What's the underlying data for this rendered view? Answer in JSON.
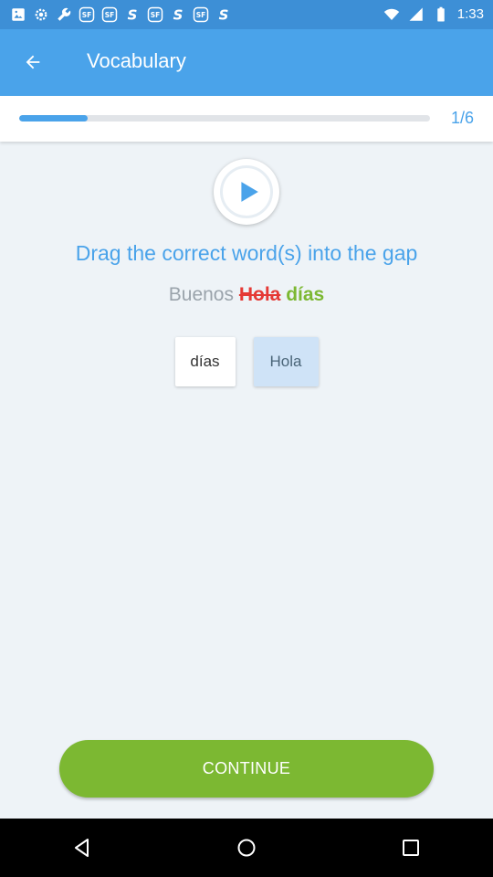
{
  "status_bar": {
    "time": "1:33",
    "icons": [
      "photo-icon",
      "settings-icon",
      "wrench-icon",
      "sf-icon",
      "sf-icon",
      "s-icon",
      "sf-icon",
      "s-icon",
      "sf-icon",
      "s-icon",
      "wifi-icon",
      "signal-icon",
      "battery-icon"
    ]
  },
  "app_bar": {
    "title": "Vocabulary",
    "back_icon": "arrow-left-icon"
  },
  "progress": {
    "value": 0.1667,
    "label": "1/6"
  },
  "exercise": {
    "play_icon": "play-icon",
    "instruction": "Drag the correct word(s) into the gap",
    "sentence": {
      "word1": "Buenos",
      "wrong": "Hola",
      "correct": "días"
    },
    "options": [
      {
        "label": "días",
        "selected": false
      },
      {
        "label": "Hola",
        "selected": true
      }
    ]
  },
  "continue_label": "CONTINUE",
  "colors": {
    "primary": "#4aa3ea",
    "status_bar": "#3d8fd6",
    "success": "#7cb832",
    "error": "#e53935"
  },
  "nav": [
    "back-icon",
    "home-icon",
    "recents-icon"
  ]
}
